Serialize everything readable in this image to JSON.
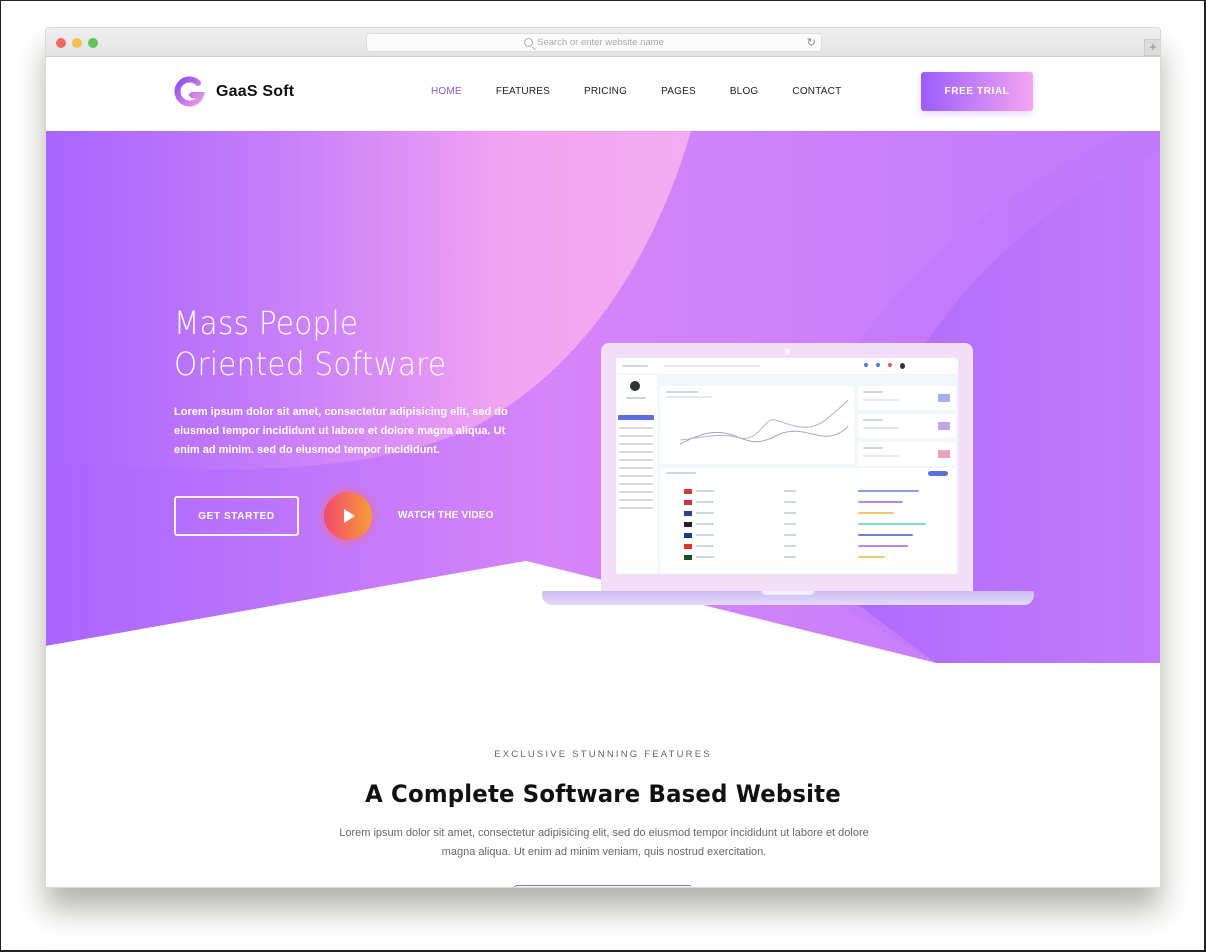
{
  "browser": {
    "url_placeholder": "Search or enter website name",
    "icons": {
      "search": "search-icon",
      "reload": "reload-icon",
      "new_tab": "plus-icon"
    },
    "reload_glyph": "↻",
    "new_tab_glyph": "+"
  },
  "nav": {
    "brand": "GaaS Soft",
    "items": [
      {
        "label": "HOME",
        "active": true
      },
      {
        "label": "FEATURES",
        "active": false
      },
      {
        "label": "PRICING",
        "active": false
      },
      {
        "label": "PAGES",
        "active": false
      },
      {
        "label": "BLOG",
        "active": false
      },
      {
        "label": "CONTACT",
        "active": false
      }
    ],
    "cta_label": "FREE TRIAL"
  },
  "hero": {
    "title_line1": "Mass People",
    "title_line2": "Oriented Software",
    "description": "Lorem ipsum dolor sit amet, consectetur adipisicing elit, sed do eiusmod tempor incididunt ut labore et dolore magna aliqua. Ut enim ad minim. sed do eiusmod tempor incididunt.",
    "primary_button": "GET STARTED",
    "video_link": "WATCH THE VIDEO"
  },
  "features": {
    "kicker": "EXCLUSIVE STUNNING FEATURES",
    "title": "A Complete Software Based Website",
    "description": "Lorem ipsum dolor sit amet, consectetur adipisicing elit, sed do eiusmod tempor incididunt ut labore et dolore magna aliqua. Ut enim ad minim veniam, quis nostrud exercitation."
  },
  "colors": {
    "accent": "#8a55d8",
    "hero_start": "#a966ff",
    "hero_pink": "#f4a6f2",
    "cta_start": "#9b5cff",
    "cta_end": "#f3a5ef",
    "play_start": "#f24a6c",
    "play_end": "#f79b3a"
  },
  "mockup": {
    "stat_card_colors": [
      "#8d9be6",
      "#b58ae6",
      "#e68aa6"
    ],
    "country_bar_colors": [
      "#8d9be6",
      "#b58ae6",
      "#f3c86a",
      "#7ee0c0",
      "#6f7fd8",
      "#b58ae6",
      "#f3c86a"
    ],
    "country_bar_fill": [
      0.68,
      0.5,
      0.4,
      0.76,
      0.61,
      0.55,
      0.3
    ],
    "flag_colors": [
      "#d93a3a",
      "#c9344a",
      "#2c3f8f",
      "#222222",
      "#1f3a8a",
      "#e0381e",
      "#1f4a20"
    ]
  }
}
